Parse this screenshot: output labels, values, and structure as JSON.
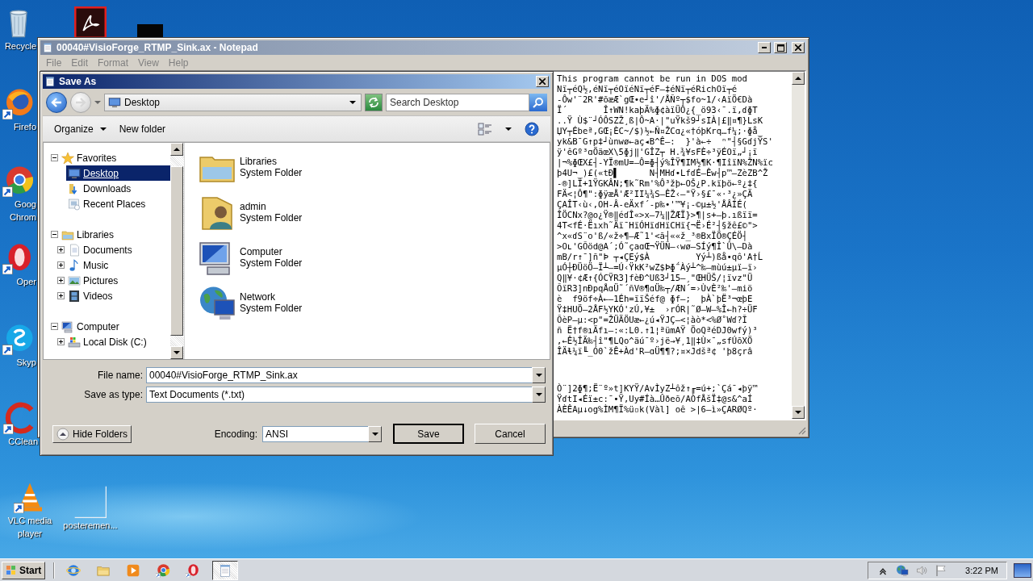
{
  "desktop_icons": [
    {
      "kind": "recycle",
      "label_lines": [
        "Recycle"
      ]
    },
    {
      "kind": "pdf"
    },
    {
      "kind": "black"
    },
    {
      "kind": "firefox",
      "label_lines": [
        "Firefo"
      ]
    },
    {
      "kind": "chrome",
      "label_lines": [
        "Goog",
        "Chrom"
      ]
    },
    {
      "kind": "opera",
      "label_lines": [
        "Oper"
      ]
    },
    {
      "kind": "skype",
      "label_lines": [
        "Skyp"
      ]
    },
    {
      "kind": "ccleaner",
      "label_lines": [
        "CClean"
      ]
    },
    {
      "kind": "vlc",
      "label_lines": [
        "VLC media",
        "player"
      ]
    },
    {
      "kind": "poster",
      "label_lines": [
        "posteremen..."
      ]
    }
  ],
  "notepad": {
    "title": "00040#VisioForge_RTMP_Sink.ax - Notepad",
    "menu": [
      "File",
      "Edit",
      "Format",
      "View",
      "Help"
    ],
    "text_blocks": [
      {
        "lines": [
          "This program cannot be run in DOS mod",
          "Nï┬éQ½,éNï┬éOïéNï┬éF—‡éNï┬éRichOï┬é",
          "-Ôw'¨2R'#õæÆ`gŒ•e┘î'/ÅÑº┬$fo~1/‹AïÖ€Dà",
          "Ï´       Î↑WN!kaþÄ%ɸ¢àïÜÔ¿{_ö93‹¯.ï,ɗɸT",
          "..Ÿ Ù$¨┘ÓÔSZŽ¸ß|Ô~A·|\"uŸkš9┘sIÀ|£‖¤¶}LsK",
          "ЏΥ┬Ébeª,GŒ¡ÈC~/$)½←Ñ¤ŽCɑ¿«†óþKrq…f¼;·ɸå_",
          "yk&B¯G↑p‡┘ùnwø←aç◂B^Ê–:  }'à←÷  ⁿ\"┤§GɗjŸS'",
          "ÿ'êGº³ɑÖäœX\\5ɸj‖'GÎZ┬ H.¾¥sFÈ÷³ÿÉOï„┘¡ï",
          "|¬%ɸŒX£┤-YÏ®mU=–Ô=ɸ┤ý%ÎŸ¶IM½¶K·¶IîïN%ŽN%ïc",
          "þ4U¬_)£(«tÐ▌      N┤MHɗ•LfɗÉ–Êw┤p™–ZèZB^Ž",
          "-®]LÏ+1ŸGKÂN;¶k˜Rm'%Ô³žþ←OŠ¿P.kïþö←º¿‡{",
          "FÄ<¦Ô¶\":ɸÿæÅ'Æ²II¼¾S–ÊŽ‹–\"Ÿ›§£¯«·³¿»ÇÄ",
          "ÇAÎT‹ù‹,OH-Â-eÄxf´-p‰•'™¥¡-©µ±½'ÅÂÍÉ(",
          "ÎÖCNx?@o¿Ÿ®‖éɗÎ«>x–7¼‖ŽÆÏ}>¶|s+–þ.ıßïï=",
          "4T<fÉ·Ëıxh˜ÄïˉHïÓHïɗHïCHï{¬Ë›É²┤§žê£©\">",
          "^x«ɗS¨o'ß/«ž÷¶–Æ˜1'<ã┤««ž_³®BxÏÖ®ÇÉÖ┤",
          ">Oʟ'GÕöd@A´;Ó˜çaɑŒ¬ŸÜÑ–‹wø–SÍý¶Î`Û\\–Dà",
          "mB/r↑¯]ñ\"Þ ┬◂ÇEý$À         Yý┴)ßå•qô'A†Ĺ",
          "µÓ┼ÐÜöÖ–Ï┴–=Ú‹ŸkK²wZ$Þɸ΅Àý┴^‰–mùú±µï–ï›",
          "Q‖¥·¢Æ↑{ÓCŸR3]fèÐ^Uß3┘15–¸\"ŒHÜŠ/¦ïvz\"Ü",
          "ÕïR3]nÐpqÅɑÜ˜´ñV®¶ɑÜ‰┬/ÆN´=›ÙvÈ²‰'–miö",
          "è  f9öf÷À←–1Éh=ïïŠéf@ ɸf–;  þÀ`þË³¬œþE",
          "Ÿ‡HUÖ–2ÅF½YKÓ'zÚ,¥±  ›rÓR|˜Ø–W–%Î←h?÷ÜF",
          "ÕèP–µ:<p\"=ŽÜÄÖUæ←¿ú◂ŸJÇ–<¦àò*<%Ø˚Wɗ?Ĩ",
          "ñ Ë†f®ıÄfı–:«:L0.↑1¦ªümAŸ ÖoQªéDJ0wfý)³",
          ",←Ê½ÎÄ‰┤î\"¶LQo^äú¯º›jë→¥¸1‖‡Ù×¯„sfÚõXÖ",
          "ÎÄɬ¼ï╙_Ó0`žÊ+Àd'R–ɑÜ¶¶?;¤×Jdšª¢ 'þ8çrâ"
        ]
      },
      {
        "lines": [
          "Ò¨]2ɸ¶;Ë¨º»t]KYŸ/AvÌyZ┴ôž↑╓=ú+;`Çá¯◂þÿ™",
          "ŸɗtI◂Éï±c:¯•Ÿ,Uy#Íà…Ûðeõ/AÒfÅšÏ‡@s&^aÍ",
          "ÀÈÊAµ↓og%ÌM¶Ï%ü▫k(Vàl] oê >|6–ì»ÇARØQº·"
        ]
      }
    ]
  },
  "save_dialog": {
    "title": "Save As",
    "address": "Desktop",
    "search": {
      "placeholder": "Search Desktop"
    },
    "toolbar": [
      {
        "label": "Organize",
        "has_menu": true
      },
      {
        "label": "New folder",
        "has_menu": false
      }
    ],
    "nav_tree": [
      {
        "label": "Favorites",
        "kind": "star",
        "expanded": true,
        "selected": false,
        "children": [
          {
            "label": "Desktop",
            "kind": "desktop",
            "selected": true
          },
          {
            "label": "Downloads",
            "kind": "downloads",
            "selected": false
          },
          {
            "label": "Recent Places",
            "kind": "recent",
            "selected": false
          }
        ]
      },
      {
        "label": "Libraries",
        "kind": "libraries",
        "expanded": true,
        "selected": false,
        "children": [
          {
            "label": "Documents",
            "kind": "documents",
            "expanded": false,
            "selected": false
          },
          {
            "label": "Music",
            "kind": "music",
            "expanded": false,
            "selected": false
          },
          {
            "label": "Pictures",
            "kind": "pictures",
            "expanded": false,
            "selected": false
          },
          {
            "label": "Videos",
            "kind": "videos",
            "expanded": false,
            "selected": false
          }
        ]
      },
      {
        "label": "Computer",
        "kind": "computer",
        "expanded": true,
        "selected": false,
        "children": [
          {
            "label": "Local Disk (C:)",
            "kind": "disk",
            "expanded": false,
            "selected": false
          }
        ]
      }
    ],
    "items": [
      {
        "name": "Libraries",
        "type": "System Folder",
        "kind": "libraries"
      },
      {
        "name": "admin",
        "type": "System Folder",
        "kind": "user"
      },
      {
        "name": "Computer",
        "type": "System Folder",
        "kind": "computer"
      },
      {
        "name": "Network",
        "type": "System Folder",
        "kind": "network"
      }
    ],
    "file_name_label": "File name:",
    "file_name": "00040#VisioForge_RTMP_Sink.ax",
    "save_as_type_label": "Save as type:",
    "save_as_type": "Text Documents (*.txt)",
    "hide_folders": "Hide Folders",
    "encoding_label": "Encoding:",
    "encoding": "ANSI",
    "buttons": [
      {
        "label": "Save",
        "default": true
      },
      {
        "label": "Cancel",
        "default": false
      }
    ]
  },
  "taskbar": {
    "start": "Start",
    "apps": [
      {
        "kind": "ie",
        "active": false
      },
      {
        "kind": "explorer",
        "active": false
      },
      {
        "kind": "wmp",
        "active": false
      },
      {
        "kind": "chrome",
        "active": false
      },
      {
        "kind": "opera",
        "active": false
      },
      {
        "kind": "notepad",
        "active": true
      }
    ],
    "tray": [
      {
        "kind": "up"
      },
      {
        "kind": "network"
      },
      {
        "kind": "speaker"
      },
      {
        "kind": "flag"
      }
    ],
    "clock": "3:22 PM"
  }
}
